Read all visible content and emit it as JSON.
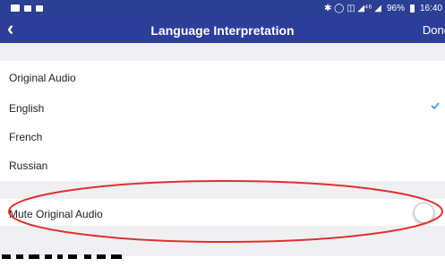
{
  "status_bar": {
    "indicators": "✱ ◯ ◫ ◢⁴⁶ ◢",
    "battery": "96%",
    "time": "16:40"
  },
  "nav": {
    "back_icon": "‹",
    "title": "Language Interpretation",
    "done_label": "Done"
  },
  "languages": [
    {
      "label": "Original Audio",
      "selected": false
    },
    {
      "label": "English",
      "selected": true
    },
    {
      "label": "French",
      "selected": false
    },
    {
      "label": "Russian",
      "selected": false
    }
  ],
  "mute": {
    "label": "Mute Original Audio",
    "enabled": false
  },
  "colors": {
    "header": "#2d3e9a",
    "check": "#3a8ee6",
    "annotation": "#e03030"
  },
  "icons": [
    "back-chevron-icon",
    "checkmark-icon",
    "toggle-switch-icon"
  ]
}
